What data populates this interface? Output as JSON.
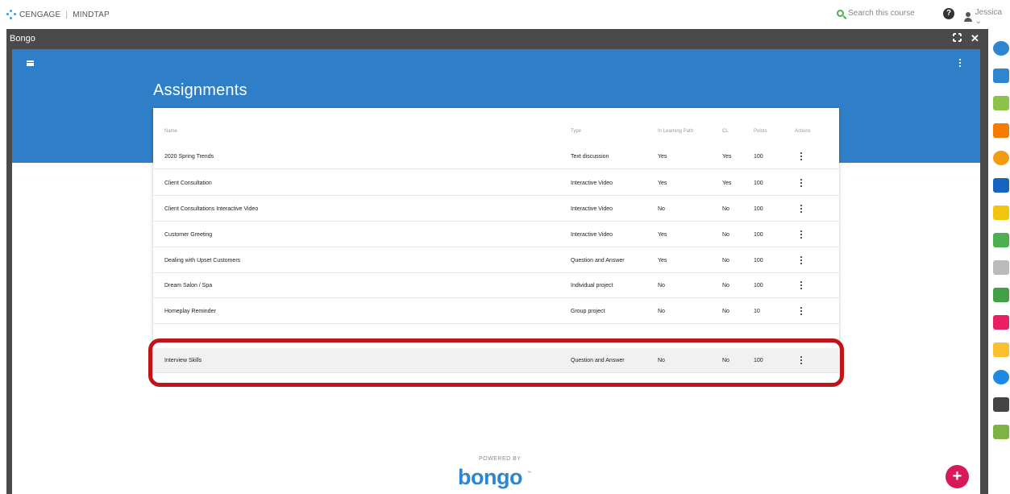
{
  "topbar": {
    "brand_left": "CENGAGE",
    "brand_right": "MINDTAP",
    "search_placeholder": "Search this course",
    "user_name": "Jessica ⌄"
  },
  "window": {
    "title": "Bongo",
    "expand_icon": "expand-icon",
    "close_glyph": "✕"
  },
  "header": {
    "title": "Assignments"
  },
  "table": {
    "columns": [
      "Name",
      "Type",
      "In Learning Path",
      "CL",
      "Points",
      "Actions"
    ],
    "rows": [
      {
        "name": "2020 Spring Trends",
        "type": "Text discussion",
        "path": "Yes",
        "cl": "Yes",
        "points": "100"
      },
      {
        "name": "Client Consultation",
        "type": "Interactive Video",
        "path": "Yes",
        "cl": "Yes",
        "points": "100"
      },
      {
        "name": "Client Consultations Interactive Video",
        "type": "Interactive Video",
        "path": "No",
        "cl": "No",
        "points": "100"
      },
      {
        "name": "Customer Greeting",
        "type": "Interactive Video",
        "path": "Yes",
        "cl": "No",
        "points": "100"
      },
      {
        "name": "Dealing with Upset Customers",
        "type": "Question and Answer",
        "path": "Yes",
        "cl": "No",
        "points": "100"
      },
      {
        "name": "Dream Salon / Spa",
        "type": "Individual project",
        "path": "No",
        "cl": "No",
        "points": "100"
      },
      {
        "name": "Homeplay Reminder",
        "type": "Group project",
        "path": "No",
        "cl": "No",
        "points": "10"
      },
      {
        "name": "Interview Skills",
        "type": "Question and Answer",
        "path": "No",
        "cl": "No",
        "points": "100"
      }
    ]
  },
  "footer": {
    "powered_by": "POWERED BY",
    "brand": "bongo",
    "tm": "™",
    "fab": "+"
  },
  "colors": {
    "header_blue": "#2f7fc8",
    "highlight_red": "#c0141b",
    "fab_pink": "#d7185a",
    "bongo_blue": "#2e86d0"
  },
  "dock": [
    {
      "icon": "cengage-app-icon",
      "color": "#2e86d0"
    },
    {
      "icon": "notebook-app-icon",
      "color": "#2e86d0"
    },
    {
      "icon": "highlighter-app-icon",
      "color": "#8bc34a"
    },
    {
      "icon": "rss-app-icon",
      "color": "#f57c00"
    },
    {
      "icon": "bongo-app-icon",
      "color": "#f39c12"
    },
    {
      "icon": "book-app-icon",
      "color": "#1565c0"
    },
    {
      "icon": "notes-app-icon",
      "color": "#f1c40f"
    },
    {
      "icon": "progress-app-icon",
      "color": "#4caf50"
    },
    {
      "icon": "chat-app-icon",
      "color": "#bbbbbb"
    },
    {
      "icon": "s-app-icon",
      "color": "#43a047"
    },
    {
      "icon": "message-app-icon",
      "color": "#e91e63"
    },
    {
      "icon": "dictionary-app-icon",
      "color": "#fbc02d"
    },
    {
      "icon": "analytics-app-icon",
      "color": "#1e88e5"
    },
    {
      "icon": "search-app-icon",
      "color": "#444444"
    },
    {
      "icon": "ring-app-icon",
      "color": "#7cb342"
    }
  ]
}
